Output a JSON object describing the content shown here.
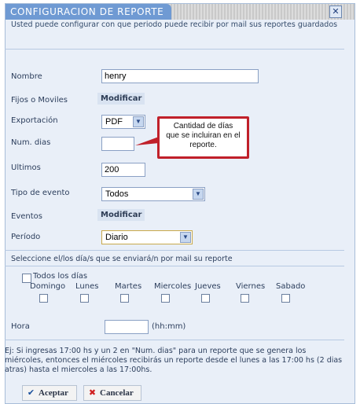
{
  "dialog": {
    "title": "CONFIGURACION DE REPORTE",
    "close_label": "✕",
    "intro": "Usted puede configurar con que periodo puede recibir por mail sus reportes guardados"
  },
  "form": {
    "nombre": {
      "label": "Nombre",
      "value": "henry"
    },
    "fijos": {
      "label": "Fijos o Moviles",
      "button": "Modificar"
    },
    "exportacion": {
      "label": "Exportación",
      "value": "PDF"
    },
    "num_dias": {
      "label": "Num. dias",
      "value": ""
    },
    "ultimos": {
      "label": "Ultimos",
      "value": "200"
    },
    "tipo_evento": {
      "label": "Tipo de evento",
      "value": "Todos"
    },
    "eventos": {
      "label": "Eventos",
      "button": "Modificar"
    },
    "periodo": {
      "label": "Período",
      "value": "Diario"
    }
  },
  "tooltip": {
    "line1": "Cantidad de días",
    "line2": "que se incluiran en el",
    "line3": "reporte."
  },
  "days_section": {
    "heading": "Seleccione el/los día/s que se enviará/n por mail su reporte",
    "all_days": "Todos los días",
    "days": [
      "Domingo",
      "Lunes",
      "Martes",
      "Miercoles",
      "Jueves",
      "Viernes",
      "Sabado"
    ]
  },
  "hora": {
    "label": "Hora",
    "value": "",
    "hint": "(hh:mm)"
  },
  "footer_note": "Ej: Si ingresas 17:00 hs y un 2 en \"Num. dias\" para un reporte que se genera los miércoles, entonces el miércoles recibirás un reporte desde el lunes a las 17:00 hs (2 dias atras) hasta el miercoles a las 17:00hs.",
  "actions": {
    "accept": "Aceptar",
    "cancel": "Cancelar"
  },
  "colors": {
    "accent": "#6f9ad3",
    "tooltip_border": "#c0202a",
    "panel": "#e9eff8"
  }
}
